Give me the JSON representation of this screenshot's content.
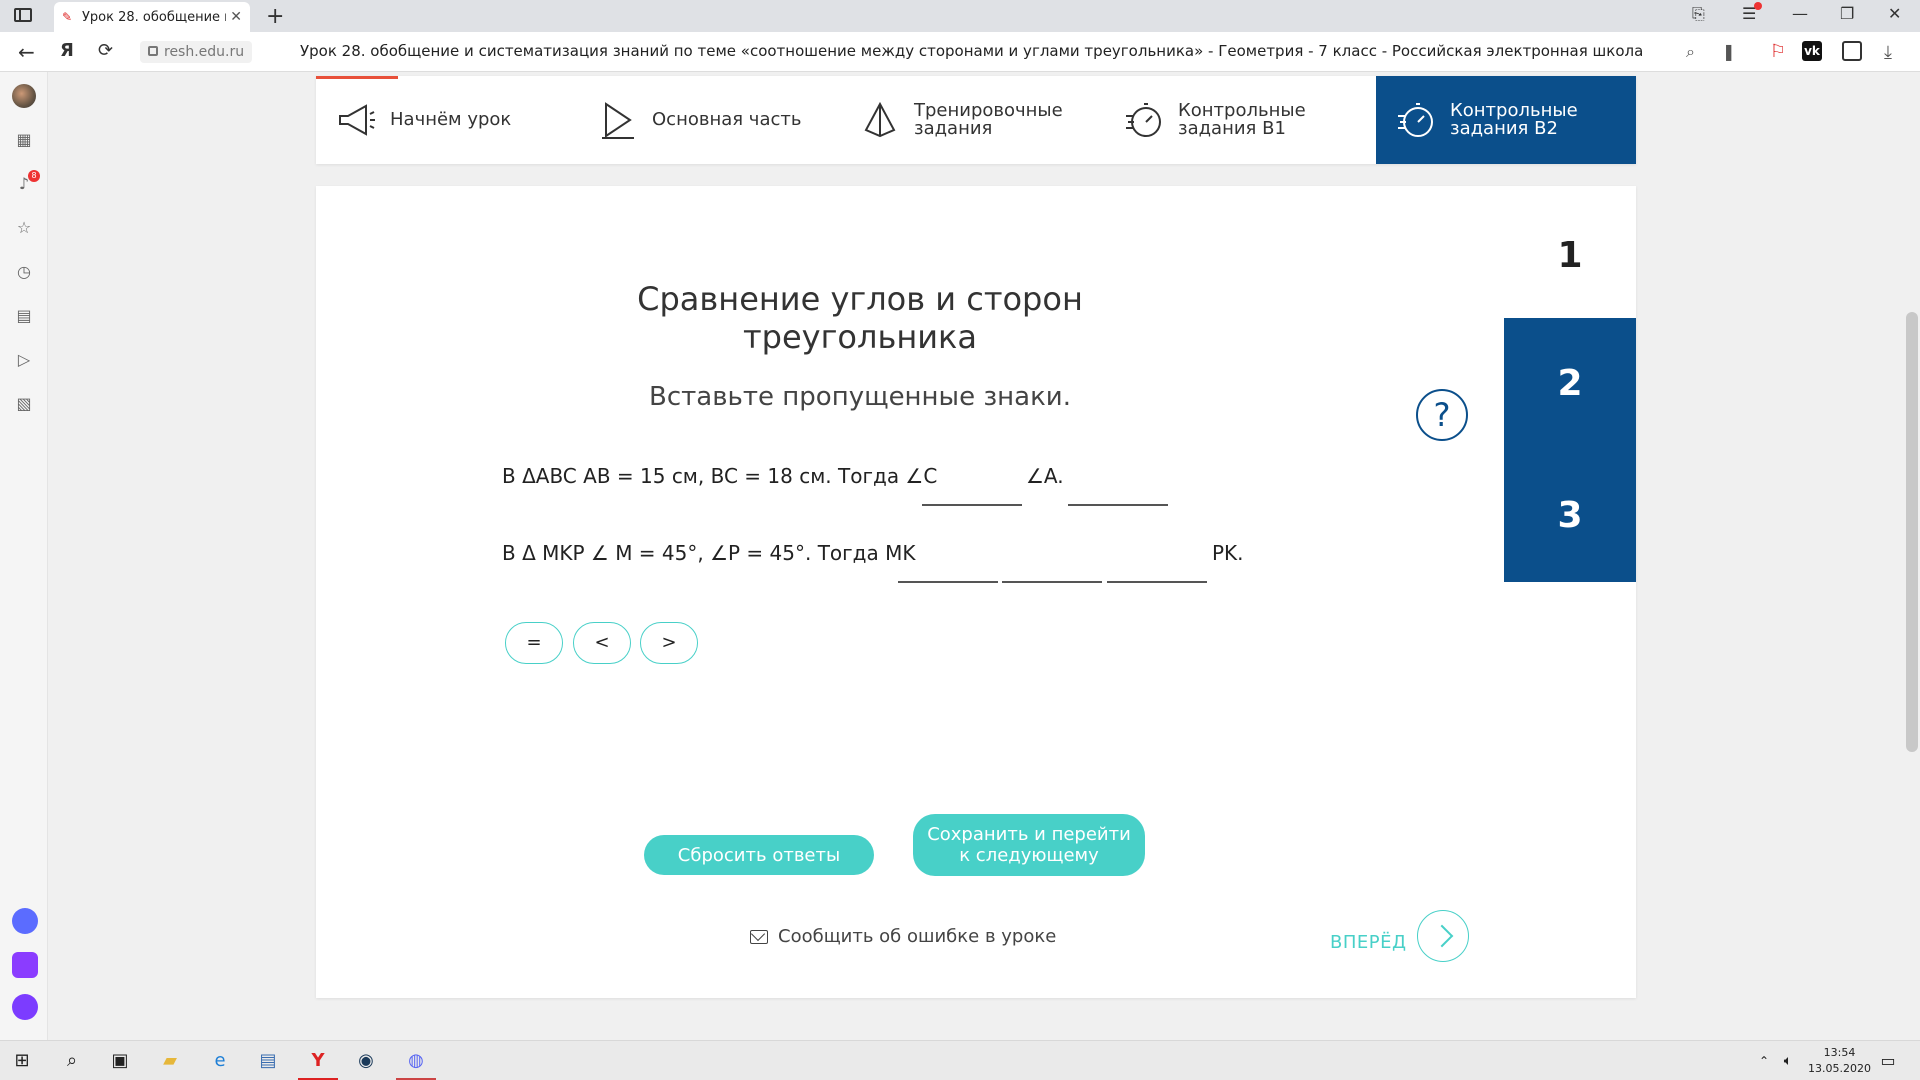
{
  "browser": {
    "tab_title": "Урок 28. обобщение и с",
    "domain": "resh.edu.ru",
    "page_title": "Урок 28. обобщение и систематизация знаний по теме «соотношение между сторонами и углами треугольника» - Геометрия - 7 класс - Российская электронная школа",
    "yandex_letter": "Я"
  },
  "sidebar": {
    "notification_count": "8"
  },
  "lesson_nav": {
    "items": [
      {
        "label": "Начнём урок"
      },
      {
        "label": "Основная часть"
      },
      {
        "label": "Тренировочные задания"
      },
      {
        "label": "Контрольные задания В1"
      },
      {
        "label": "Контрольные задания В2"
      }
    ],
    "active_index": 4
  },
  "task": {
    "title": "Сравнение углов и сторон треугольника",
    "instruction": "Вставьте пропущенные знаки.",
    "line1_prefix": "В ΔABC AB = 15 см, BC = 18 см. Тогда ∠C",
    "line1_suffix": "∠A.",
    "line2_prefix": "В Δ MKP ∠ M = 45°, ∠P = 45°. Тогда MK",
    "line2_suffix": "PK.",
    "chips": [
      "=",
      "<",
      ">"
    ],
    "numbers": [
      "1",
      "2",
      "3"
    ]
  },
  "buttons": {
    "reset": "Сбросить ответы",
    "save": "Сохранить и перейти к следующему",
    "report": "Сообщить об ошибке в уроке",
    "next": "ВПЕРЁД"
  },
  "taskbar": {
    "time": "13:54",
    "date": "13.05.2020"
  },
  "colors": {
    "primary": "#0b4f8b",
    "accent": "#48d0c8",
    "highlight": "#e8503a"
  }
}
